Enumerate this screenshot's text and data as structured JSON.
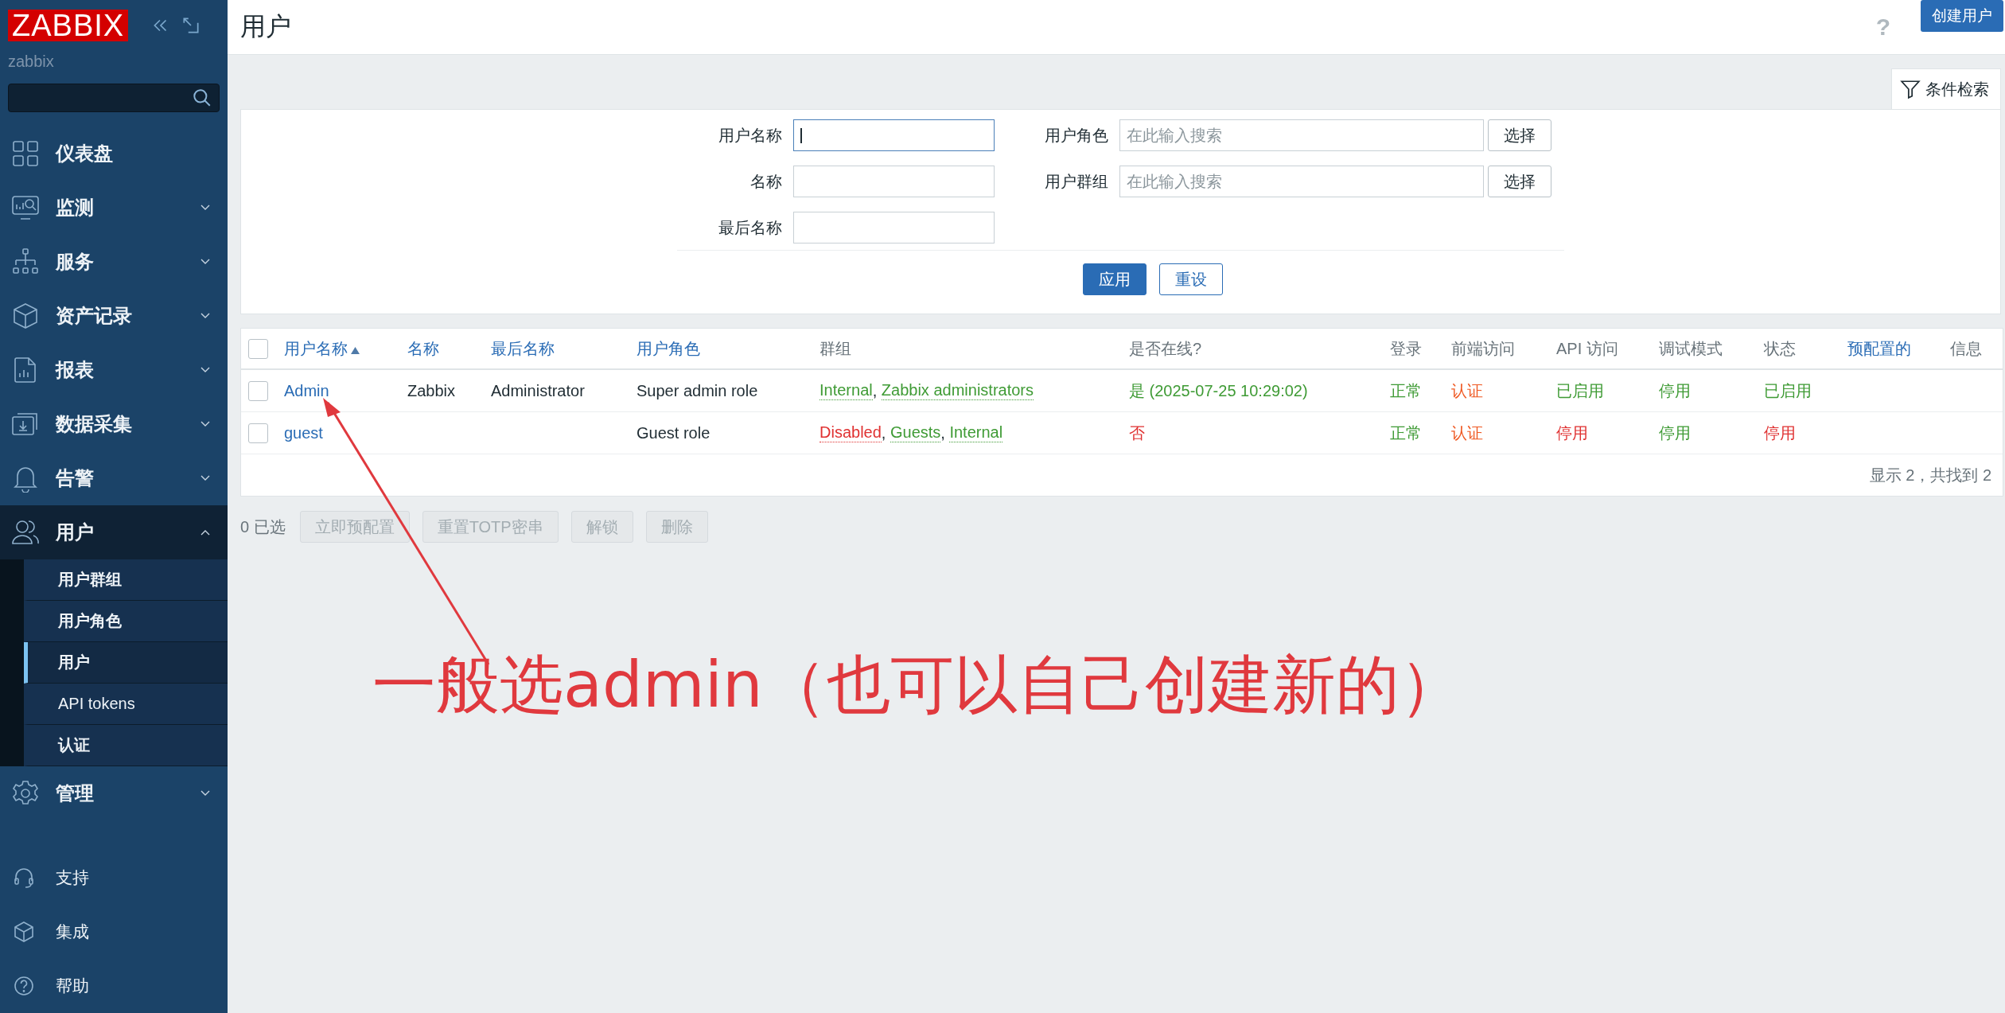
{
  "sidebar": {
    "logo": "ZABBIX",
    "server_name": "zabbix",
    "menu": [
      {
        "label": "仪表盘",
        "kind": "link",
        "expanded": false
      },
      {
        "label": "监测",
        "kind": "menu",
        "expanded": false
      },
      {
        "label": "服务",
        "kind": "menu",
        "expanded": false
      },
      {
        "label": "资产记录",
        "kind": "menu",
        "expanded": false
      },
      {
        "label": "报表",
        "kind": "menu",
        "expanded": false
      },
      {
        "label": "数据采集",
        "kind": "menu",
        "expanded": false
      },
      {
        "label": "告警",
        "kind": "menu",
        "expanded": false
      },
      {
        "label": "用户",
        "kind": "menu",
        "expanded": true,
        "children": [
          {
            "label": "用户群组",
            "selected": false
          },
          {
            "label": "用户角色",
            "selected": false
          },
          {
            "label": "用户",
            "selected": true
          },
          {
            "label": "API tokens",
            "selected": false
          },
          {
            "label": "认证",
            "selected": false
          }
        ]
      },
      {
        "label": "管理",
        "kind": "menu",
        "expanded": false
      }
    ],
    "bottom": [
      {
        "label": "支持"
      },
      {
        "label": "集成"
      },
      {
        "label": "帮助"
      }
    ]
  },
  "header": {
    "title": "用户",
    "help": "?",
    "create_button": "创建用户"
  },
  "filter": {
    "tab_label": "条件检索",
    "columns": [
      [
        {
          "label": "用户名称",
          "kind": "text",
          "focused": true
        },
        {
          "label": "名称",
          "kind": "text",
          "focused": false
        },
        {
          "label": "最后名称",
          "kind": "text",
          "focused": false
        }
      ],
      [
        {
          "label": "用户角色",
          "kind": "multiselect",
          "focused": false,
          "placeholder": "在此输入搜索",
          "button": "选择"
        },
        {
          "label": "用户群组",
          "kind": "multiselect",
          "focused": false,
          "placeholder": "在此输入搜索",
          "button": "选择"
        }
      ]
    ],
    "buttons": [
      {
        "label": "应用",
        "kind": "primary"
      },
      {
        "label": "重设",
        "kind": "secondary"
      }
    ]
  },
  "table": {
    "header_checkbox": {
      "checked": false
    },
    "columns": [
      {
        "label": "用户名称",
        "sortable": true,
        "sorted": true
      },
      {
        "label": "名称",
        "sortable": true,
        "sorted": false
      },
      {
        "label": "最后名称",
        "sortable": true,
        "sorted": false
      },
      {
        "label": "用户角色",
        "sortable": true,
        "sorted": false
      },
      {
        "label": "群组",
        "sortable": false,
        "sorted": false
      },
      {
        "label": "是否在线?",
        "sortable": false,
        "sorted": false
      },
      {
        "label": "登录",
        "sortable": false,
        "sorted": false
      },
      {
        "label": "前端访问",
        "sortable": false,
        "sorted": false
      },
      {
        "label": "API 访问",
        "sortable": false,
        "sorted": false
      },
      {
        "label": "调试模式",
        "sortable": false,
        "sorted": false
      },
      {
        "label": "状态",
        "sortable": false,
        "sorted": false
      },
      {
        "label": "预配置的",
        "sortable": true,
        "sorted": false
      },
      {
        "label": "信息",
        "sortable": false,
        "sorted": false
      }
    ],
    "rows": [
      {
        "checked": false,
        "cells": [
          {
            "kind": "link",
            "text": "Admin"
          },
          {
            "kind": "text",
            "text": "Zabbix"
          },
          {
            "kind": "text",
            "text": "Administrator"
          },
          {
            "kind": "text",
            "text": "Super admin role"
          },
          {
            "kind": "groups",
            "separator": ", ",
            "items": [
              {
                "text": "Internal",
                "color": "#3f9b35"
              },
              {
                "text": "Zabbix administrators",
                "color": "#3f9b35"
              }
            ]
          },
          {
            "kind": "status",
            "text": "是 (2025-07-25 10:29:02)",
            "color": "#3f9b35"
          },
          {
            "kind": "status",
            "text": "正常",
            "color": "#3f9b35"
          },
          {
            "kind": "status",
            "text": "认证",
            "color": "#ef5a24"
          },
          {
            "kind": "status",
            "text": "已启用",
            "color": "#3f9b35"
          },
          {
            "kind": "status",
            "text": "停用",
            "color": "#3f9b35"
          },
          {
            "kind": "status",
            "text": "已启用",
            "color": "#3f9b35"
          }
        ]
      },
      {
        "checked": false,
        "cells": [
          {
            "kind": "link",
            "text": "guest"
          },
          {
            "kind": "empty"
          },
          {
            "kind": "empty"
          },
          {
            "kind": "text",
            "text": "Guest role"
          },
          {
            "kind": "groups",
            "separator": ", ",
            "items": [
              {
                "text": "Disabled",
                "color": "#e03131"
              },
              {
                "text": "Guests",
                "color": "#3f9b35"
              },
              {
                "text": "Internal",
                "color": "#3f9b35"
              }
            ]
          },
          {
            "kind": "status",
            "text": "否",
            "color": "#e03131"
          },
          {
            "kind": "status",
            "text": "正常",
            "color": "#3f9b35"
          },
          {
            "kind": "status",
            "text": "认证",
            "color": "#ef5a24"
          },
          {
            "kind": "status",
            "text": "停用",
            "color": "#e03131"
          },
          {
            "kind": "status",
            "text": "停用",
            "color": "#3f9b35"
          },
          {
            "kind": "status",
            "text": "停用",
            "color": "#e03131"
          }
        ]
      }
    ],
    "footer": "显示 2，共找到 2"
  },
  "mass_actions": {
    "selected_count": "0 已选",
    "buttons": [
      {
        "label": "立即预配置",
        "disabled": true
      },
      {
        "label": "重置TOTP密串",
        "disabled": true
      },
      {
        "label": "解锁",
        "disabled": true
      },
      {
        "label": "删除",
        "disabled": true
      }
    ]
  },
  "annotation": {
    "text": "一般选admin（也可以自己创建新的）"
  }
}
